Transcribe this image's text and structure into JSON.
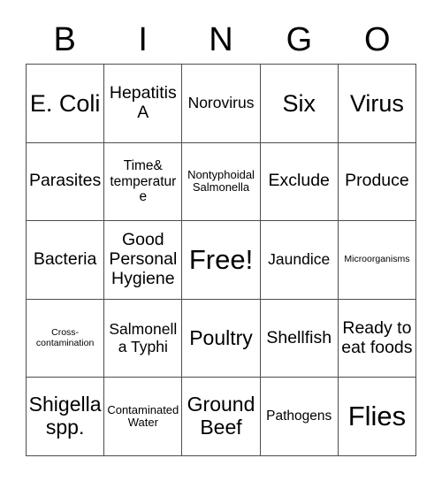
{
  "card": {
    "header": {
      "letters": [
        "B",
        "I",
        "N",
        "G",
        "O"
      ]
    },
    "rows": [
      [
        {
          "text": "E. Coli",
          "size": "fs-xxl"
        },
        {
          "text": "Hepatitis A",
          "size": "fs-l"
        },
        {
          "text": "Norovirus",
          "size": "fs-m"
        },
        {
          "text": "Six",
          "size": "fs-xxl"
        },
        {
          "text": "Virus",
          "size": "fs-xxl"
        }
      ],
      [
        {
          "text": "Parasites",
          "size": "fs-l"
        },
        {
          "text": "Time& temperature",
          "size": "fs-s"
        },
        {
          "text": "Nontyphoidal Salmonella",
          "size": "fs-xs"
        },
        {
          "text": "Exclude",
          "size": "fs-l"
        },
        {
          "text": "Produce",
          "size": "fs-l"
        }
      ],
      [
        {
          "text": "Bacteria",
          "size": "fs-l"
        },
        {
          "text": "Good Personal Hygiene",
          "size": "fs-l"
        },
        {
          "text": "Free!",
          "size": "fs-huge"
        },
        {
          "text": "Jaundice",
          "size": "fs-m"
        },
        {
          "text": "Microorganisms",
          "size": "fs-xxs"
        }
      ],
      [
        {
          "text": "Cross-contamination",
          "size": "fs-xxs"
        },
        {
          "text": "Salmonella Typhi",
          "size": "fs-m"
        },
        {
          "text": "Poultry",
          "size": "fs-xl"
        },
        {
          "text": "Shellfish",
          "size": "fs-l"
        },
        {
          "text": "Ready to eat foods",
          "size": "fs-l"
        }
      ],
      [
        {
          "text": "Shigella spp.",
          "size": "fs-xl"
        },
        {
          "text": "Contaminated Water",
          "size": "fs-xs"
        },
        {
          "text": "Ground Beef",
          "size": "fs-xl"
        },
        {
          "text": "Pathogens",
          "size": "fs-s"
        },
        {
          "text": "Flies",
          "size": "fs-huge"
        }
      ]
    ]
  },
  "colors": {
    "border": "#4d4d4d",
    "text": "#000000",
    "background": "#ffffff"
  }
}
